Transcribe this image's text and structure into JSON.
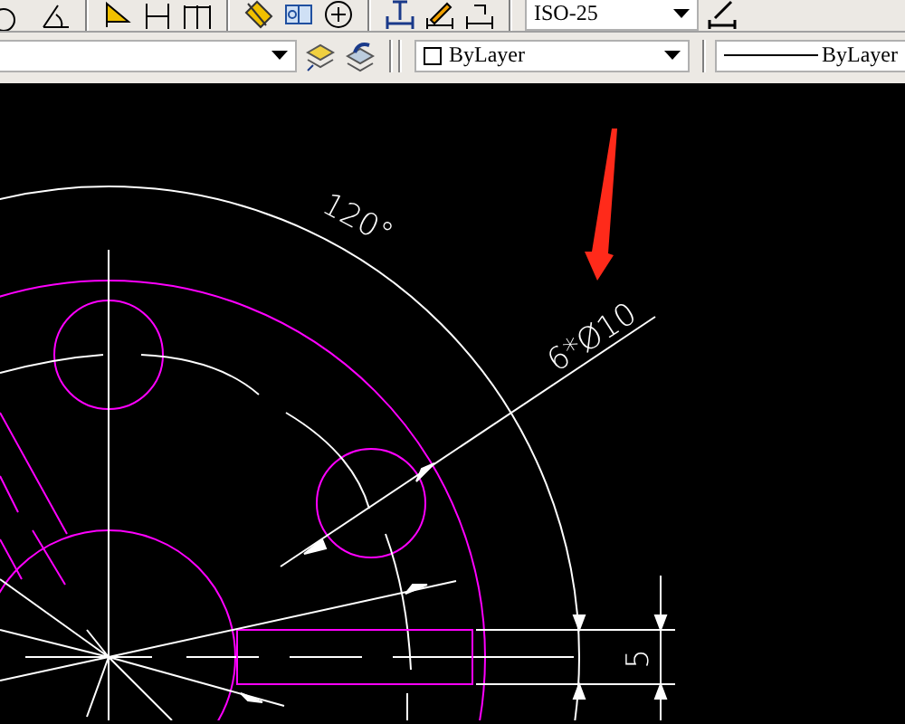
{
  "dimension_toolbar": {
    "dimstyle": "ISO-25"
  },
  "properties_toolbar": {
    "color_setting": "ByLayer",
    "linetype": "ByLayer"
  },
  "drawing": {
    "annotations": [
      {
        "kind": "angle",
        "text": "120°"
      },
      {
        "kind": "diameter",
        "text": "6*Ø10"
      },
      {
        "kind": "linear",
        "text": "5"
      }
    ]
  }
}
